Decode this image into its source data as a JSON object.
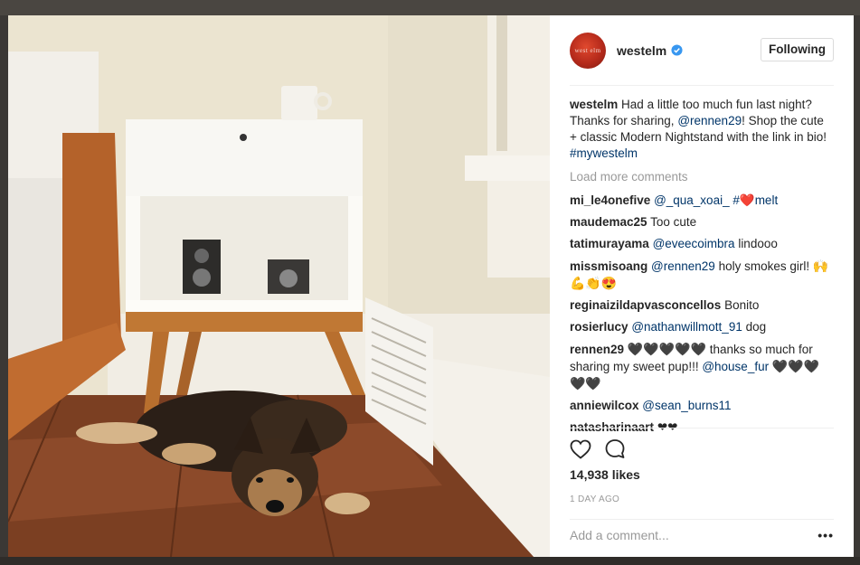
{
  "post": {
    "avatar_text": "west elm",
    "username": "westelm",
    "follow_label": "Following",
    "caption": {
      "user": "westelm",
      "text_1": "Had a little too much fun last night? Thanks for sharing,",
      "mention": "@rennen29",
      "text_2": "! Shop the cute + classic Modern Nightstand with the link in bio!",
      "hashtag": "#mywestelm"
    },
    "load_more": "Load more comments",
    "comments": [
      {
        "user": "mi_le4onefive",
        "parts": [
          {
            "t": "link",
            "v": "@_qua_xoai_"
          },
          {
            "t": "text",
            "v": " "
          },
          {
            "t": "link",
            "v": "#"
          },
          {
            "t": "heart",
            "v": "❤️"
          },
          {
            "t": "link",
            "v": "melt"
          }
        ]
      },
      {
        "user": "maudemac25",
        "parts": [
          {
            "t": "text",
            "v": "Too cute"
          }
        ]
      },
      {
        "user": "tatimurayama",
        "parts": [
          {
            "t": "link",
            "v": "@eveecoimbra"
          },
          {
            "t": "text",
            "v": " lindooo"
          }
        ]
      },
      {
        "user": "missmisoang",
        "parts": [
          {
            "t": "link",
            "v": "@rennen29"
          },
          {
            "t": "text",
            "v": " holy smokes girl! "
          },
          {
            "t": "emo",
            "v": "🙌💪👏😍"
          }
        ]
      },
      {
        "user": "reginaizildapvasconcellos",
        "parts": [
          {
            "t": "text",
            "v": "Bonito"
          }
        ]
      },
      {
        "user": "rosierlucy",
        "parts": [
          {
            "t": "link",
            "v": "@nathanwillmott_91"
          },
          {
            "t": "text",
            "v": " dog"
          }
        ]
      },
      {
        "user": "rennen29",
        "parts": [
          {
            "t": "emo",
            "v": "🖤🖤🖤🖤🖤"
          },
          {
            "t": "text",
            "v": " thanks so much for sharing my sweet pup!!! "
          },
          {
            "t": "link",
            "v": "@house_fur"
          },
          {
            "t": "text",
            "v": " "
          },
          {
            "t": "emo",
            "v": "🖤🖤🖤🖤🖤"
          }
        ]
      },
      {
        "user": "anniewilcox",
        "parts": [
          {
            "t": "link",
            "v": "@sean_burns11"
          }
        ]
      },
      {
        "user": "natasharinaart",
        "parts": [
          {
            "t": "text",
            "v": "❤❤"
          }
        ]
      }
    ],
    "likes": "14,938 likes",
    "time": "1 DAY AGO",
    "add_comment_placeholder": "Add a comment...",
    "more_label": "•••"
  },
  "icons": {
    "like": "heart-outline-icon",
    "comment": "speech-bubble-icon",
    "verified": "verified-badge-icon"
  }
}
